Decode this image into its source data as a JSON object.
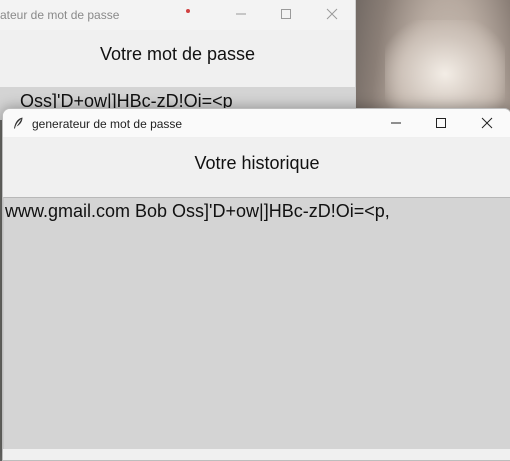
{
  "back_window": {
    "title": "ateur de mot de passe",
    "heading": "Votre mot de passe",
    "password_value": "Oss]'D+ow|]HBc-zD!Oi=<p",
    "controls": {
      "minimize": "—",
      "maximize": "☐",
      "close": "✕"
    }
  },
  "front_window": {
    "title": "generateur de mot de passe",
    "heading": "Votre historique",
    "history_entries": "www.gmail.com Bob Oss]'D+ow|]HBc-zD!Oi=<p,",
    "controls": {
      "minimize": "—",
      "maximize": "☐",
      "close": "✕"
    },
    "icon": "feather-icon"
  },
  "colors": {
    "field_bg": "#d4d4d4",
    "window_bg": "#f0f0f0"
  }
}
